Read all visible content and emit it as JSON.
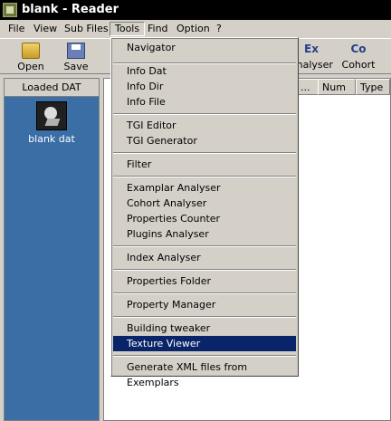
{
  "window": {
    "title": "blank - Reader"
  },
  "menubar": {
    "items": [
      {
        "label": "File"
      },
      {
        "label": "View"
      },
      {
        "label": "Sub Files"
      },
      {
        "label": "Tools"
      },
      {
        "label": "Find"
      },
      {
        "label": "Option"
      },
      {
        "label": "?"
      }
    ]
  },
  "toolbar": {
    "open_label": "Open",
    "save_label": "Save",
    "analyser_label": "Analyser",
    "analyser_icon_text": "Ex",
    "cohort_label": "Cohort",
    "cohort_icon_text": "Co"
  },
  "left_panel": {
    "header": "Loaded DAT",
    "dat_label": "blank dat"
  },
  "right_panel": {
    "columns": [
      {
        "label": "..."
      },
      {
        "label": "Num"
      },
      {
        "label": "Type"
      }
    ]
  },
  "tools_menu": {
    "items": [
      "Navigator",
      "Info Dat",
      "Info Dir",
      "Info File",
      "TGI Editor",
      "TGI Generator",
      "Filter",
      "Examplar Analyser",
      "Cohort Analyser",
      "Properties Counter",
      "Plugins Analyser",
      "Index Analyser",
      "Properties Folder",
      "Property Manager",
      "Building tweaker",
      "Texture Viewer",
      "Generate XML files from Exemplars"
    ],
    "highlighted": "Texture Viewer"
  }
}
